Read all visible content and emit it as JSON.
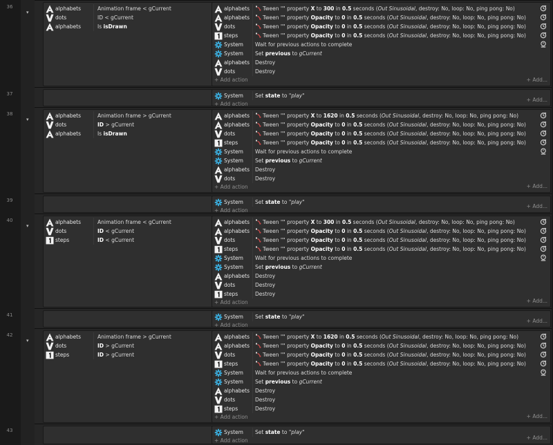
{
  "labels": {
    "add_action": "+ Add action",
    "add_more": "+ Add..."
  },
  "objects": {
    "alphabets": "alphabets",
    "dots": "dots",
    "steps": "steps",
    "system": "System"
  },
  "events": [
    {
      "line": "36",
      "conditions": [
        {
          "obj": "alphabets",
          "icon": "alphabet-a-icon",
          "pre": "Animation frame < gCurrent",
          "b": "",
          "post": ""
        },
        {
          "obj": "dots",
          "icon": "dots-v-icon",
          "pre": "ID < gCurrent",
          "b": "",
          "post": ""
        },
        {
          "obj": "alphabets",
          "icon": "alphabet-a-icon",
          "pre": "Is ",
          "b": "isDrawn",
          "post": ""
        }
      ],
      "actions": [
        {
          "obj": "alphabets",
          "icon": "alphabet-a-icon",
          "kind": "tween",
          "prop": "X",
          "val": "300",
          "secs": "0.5"
        },
        {
          "obj": "alphabets",
          "icon": "alphabet-a-icon",
          "kind": "tween",
          "prop": "Opacity",
          "val": "0",
          "secs": "0.5"
        },
        {
          "obj": "dots",
          "icon": "dots-v-icon",
          "kind": "tween",
          "prop": "Opacity",
          "val": "0",
          "secs": "0.5"
        },
        {
          "obj": "steps",
          "icon": "steps-1-icon",
          "kind": "tween",
          "prop": "Opacity",
          "val": "0",
          "secs": "0.5"
        },
        {
          "obj": "System",
          "icon": "system-gear-icon",
          "kind": "wait"
        },
        {
          "obj": "System",
          "icon": "system-gear-icon",
          "kind": "setprev"
        },
        {
          "obj": "alphabets",
          "icon": "alphabet-a-icon",
          "kind": "destroy"
        },
        {
          "obj": "dots",
          "icon": "dots-v-icon",
          "kind": "destroy"
        }
      ]
    },
    {
      "line": "37",
      "sub": true
    },
    {
      "line": "38",
      "conditions": [
        {
          "obj": "alphabets",
          "icon": "alphabet-a-icon",
          "pre": "Animation frame > gCurrent",
          "b": "",
          "post": ""
        },
        {
          "obj": "dots",
          "icon": "dots-v-icon",
          "pre": "",
          "b": "ID",
          "post": " > gCurrent"
        },
        {
          "obj": "alphabets",
          "icon": "alphabet-a-icon",
          "pre": "Is ",
          "b": "isDrawn",
          "post": ""
        }
      ],
      "actions": [
        {
          "obj": "alphabets",
          "icon": "alphabet-a-icon",
          "kind": "tween",
          "prop": "X",
          "val": "1620",
          "secs": "0.5"
        },
        {
          "obj": "alphabets",
          "icon": "alphabet-a-icon",
          "kind": "tween",
          "prop": "Opacity",
          "val": "0",
          "secs": "0.5"
        },
        {
          "obj": "dots",
          "icon": "dots-v-icon",
          "kind": "tween",
          "prop": "Opacity",
          "val": "0",
          "secs": "0.5"
        },
        {
          "obj": "steps",
          "icon": "steps-1-icon",
          "kind": "tween",
          "prop": "Opacity",
          "val": "0",
          "secs": "0.5"
        },
        {
          "obj": "System",
          "icon": "system-gear-icon",
          "kind": "wait"
        },
        {
          "obj": "System",
          "icon": "system-gear-icon",
          "kind": "setprev"
        },
        {
          "obj": "alphabets",
          "icon": "alphabet-a-icon",
          "kind": "destroy"
        },
        {
          "obj": "dots",
          "icon": "dots-v-icon",
          "kind": "destroy"
        }
      ]
    },
    {
      "line": "39",
      "sub": true
    },
    {
      "line": "40",
      "conditions": [
        {
          "obj": "alphabets",
          "icon": "alphabet-a-icon",
          "pre": "Animation frame < gCurrent",
          "b": "",
          "post": ""
        },
        {
          "obj": "dots",
          "icon": "dots-v-icon",
          "pre": "",
          "b": "ID",
          "post": " < gCurrent"
        },
        {
          "obj": "steps",
          "icon": "steps-1-icon",
          "pre": "",
          "b": "ID",
          "post": " < gCurrent"
        }
      ],
      "actions": [
        {
          "obj": "alphabets",
          "icon": "alphabet-a-icon",
          "kind": "tween",
          "prop": "X",
          "val": "300",
          "secs": "0.5"
        },
        {
          "obj": "alphabets",
          "icon": "alphabet-a-icon",
          "kind": "tween",
          "prop": "Opacity",
          "val": "0",
          "secs": "0.5"
        },
        {
          "obj": "dots",
          "icon": "dots-v-icon",
          "kind": "tween",
          "prop": "Opacity",
          "val": "0",
          "secs": "0.5"
        },
        {
          "obj": "steps",
          "icon": "steps-1-icon",
          "kind": "tween",
          "prop": "Opacity",
          "val": "0",
          "secs": "0.5"
        },
        {
          "obj": "System",
          "icon": "system-gear-icon",
          "kind": "wait"
        },
        {
          "obj": "System",
          "icon": "system-gear-icon",
          "kind": "setprev"
        },
        {
          "obj": "alphabets",
          "icon": "alphabet-a-icon",
          "kind": "destroy"
        },
        {
          "obj": "dots",
          "icon": "dots-v-icon",
          "kind": "destroy"
        },
        {
          "obj": "steps",
          "icon": "steps-1-icon",
          "kind": "destroy"
        }
      ]
    },
    {
      "line": "41",
      "sub": true
    },
    {
      "line": "42",
      "conditions": [
        {
          "obj": "alphabets",
          "icon": "alphabet-a-icon",
          "pre": "Animation frame > gCurrent",
          "b": "",
          "post": ""
        },
        {
          "obj": "dots",
          "icon": "dots-v-icon",
          "pre": "",
          "b": "ID",
          "post": " > gCurrent"
        },
        {
          "obj": "steps",
          "icon": "steps-1-icon",
          "pre": "",
          "b": "ID",
          "post": " > gCurrent"
        }
      ],
      "actions": [
        {
          "obj": "alphabets",
          "icon": "alphabet-a-icon",
          "kind": "tween",
          "prop": "X",
          "val": "1620",
          "secs": "0.5"
        },
        {
          "obj": "alphabets",
          "icon": "alphabet-a-icon",
          "kind": "tween",
          "prop": "Opacity",
          "val": "0",
          "secs": "0.5"
        },
        {
          "obj": "dots",
          "icon": "dots-v-icon",
          "kind": "tween",
          "prop": "Opacity",
          "val": "0",
          "secs": "0.5"
        },
        {
          "obj": "steps",
          "icon": "steps-1-icon",
          "kind": "tween",
          "prop": "Opacity",
          "val": "0",
          "secs": "0.5"
        },
        {
          "obj": "System",
          "icon": "system-gear-icon",
          "kind": "wait"
        },
        {
          "obj": "System",
          "icon": "system-gear-icon",
          "kind": "setprev"
        },
        {
          "obj": "alphabets",
          "icon": "alphabet-a-icon",
          "kind": "destroy"
        },
        {
          "obj": "dots",
          "icon": "dots-v-icon",
          "kind": "destroy"
        },
        {
          "obj": "steps",
          "icon": "steps-1-icon",
          "kind": "destroy"
        }
      ]
    },
    {
      "line": "43",
      "sub": true
    }
  ],
  "text": {
    "tween_1": "Tween \"\" property ",
    "tween_to": " to ",
    "tween_in": " in ",
    "tween_secs": " seconds (",
    "tween_ease": "Out Sinusoidal",
    "tween_tail": ", destroy: No, loop: No, ping pong: No)",
    "wait": "Wait for previous actions to complete",
    "setprev_1": "Set ",
    "setprev_b": "previous",
    "setprev_2": " to ",
    "setprev_v": "gCurrent",
    "destroy": "Destroy",
    "setstate_1": "Set ",
    "setstate_b": "state",
    "setstate_2": " to ",
    "setstate_v": "\"play\""
  },
  "colors": {
    "system_icon": "#3aa9d8",
    "tween_icon": "#c94a4a"
  }
}
